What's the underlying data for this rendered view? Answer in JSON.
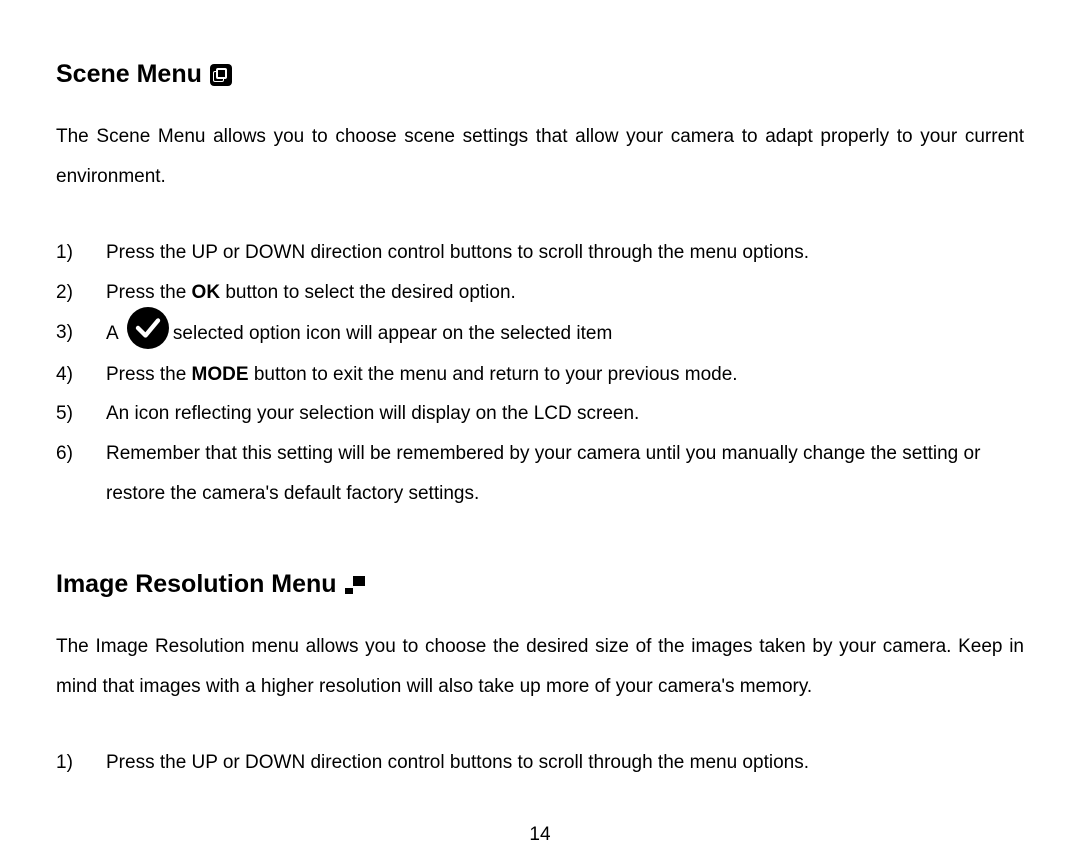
{
  "scene": {
    "heading": "Scene Menu",
    "intro": "The Scene Menu allows you to choose scene settings that allow your camera to adapt properly to your current environment.",
    "steps": {
      "s1": "Press the UP or DOWN direction control buttons to scroll through the menu options.",
      "s2_prefix": "Press the ",
      "s2_bold": "OK",
      "s2_suffix": " button to select the desired option.",
      "s3_prefix": "A  ",
      "s3_suffix": "selected option icon will appear on the selected item",
      "s4_prefix": "Press the ",
      "s4_bold": "MODE",
      "s4_suffix": " button to exit the menu and return to your previous mode.",
      "s5": "An icon reflecting your selection will display on the LCD screen.",
      "s6": "Remember that this setting will be remembered by your camera until you manually change the setting or restore the camera's default factory settings."
    }
  },
  "resolution": {
    "heading": "Image Resolution Menu",
    "intro": "The Image Resolution menu allows you to choose the desired size of the images taken by your camera. Keep in mind that images with a higher resolution will also take up more of your camera's memory.",
    "steps": {
      "s1": "Press the UP or DOWN direction control buttons to scroll through the menu options."
    }
  },
  "page_number": "14"
}
